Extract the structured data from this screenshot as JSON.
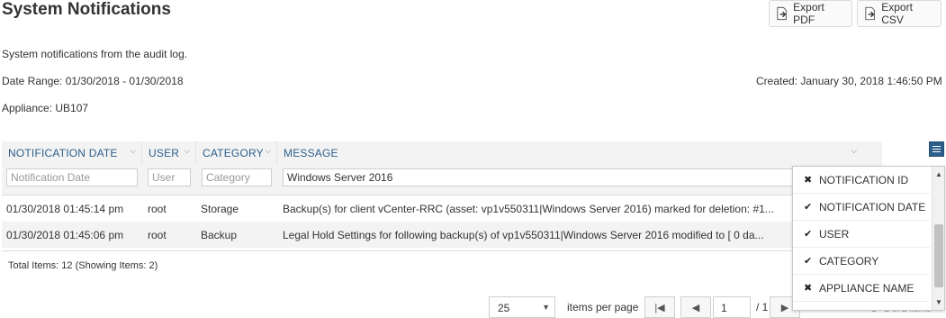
{
  "page": {
    "title": "System Notifications",
    "export_pdf_label": "Export PDF",
    "export_csv_label": "Export CSV",
    "description": "System notifications from the audit log.",
    "date_range": "Date Range: 01/30/2018 - 01/30/2018",
    "created": "Created: January 30, 2018 1:46:50 PM",
    "appliance": "Appliance: UB107"
  },
  "grid": {
    "columns": [
      {
        "label": "NOTIFICATION DATE",
        "filter_placeholder": "Notification Date",
        "filter_value": ""
      },
      {
        "label": "USER",
        "filter_placeholder": "User",
        "filter_value": ""
      },
      {
        "label": "CATEGORY",
        "filter_placeholder": "Category",
        "filter_value": ""
      },
      {
        "label": "MESSAGE",
        "filter_placeholder": "",
        "filter_value": "Windows Server 2016"
      }
    ],
    "rows": [
      {
        "date": "01/30/2018 01:45:14 pm",
        "user": "root",
        "category": "Storage",
        "message": "Backup(s) for client vCenter-RRC (asset: vp1v550311|Windows Server 2016) marked for deletion: #1..."
      },
      {
        "date": "01/30/2018 01:45:06 pm",
        "user": "root",
        "category": "Backup",
        "message": "Legal Hold Settings for following backup(s) of vp1v550311|Windows Server 2016 modified to [ 0 da..."
      }
    ],
    "total": "Total Items: 12 (Showing Items: 2)"
  },
  "pager": {
    "page_size": "25",
    "items_per_page": "items per page",
    "first_icon": "first-page-icon",
    "prev_icon": "prev-page-icon",
    "current_page": "1",
    "of_label": "/ 1",
    "next_icon": "next-page-icon",
    "info": "1 - 2 of 2 items"
  },
  "column_menu": {
    "items": [
      {
        "label": "NOTIFICATION ID",
        "checked": false
      },
      {
        "label": "NOTIFICATION DATE",
        "checked": true
      },
      {
        "label": "USER",
        "checked": true
      },
      {
        "label": "CATEGORY",
        "checked": true
      },
      {
        "label": "APPLIANCE NAME",
        "checked": false
      }
    ]
  },
  "colors": {
    "accent": "#2c5f8c",
    "header_bg": "#f3f3f3"
  }
}
